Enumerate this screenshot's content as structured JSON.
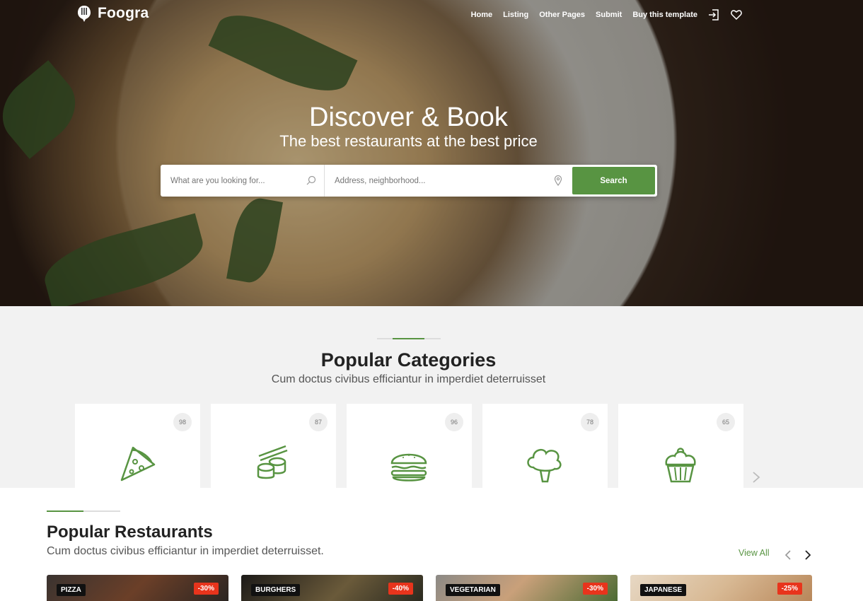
{
  "brand": {
    "name": "Foogra"
  },
  "nav": {
    "items": [
      "Home",
      "Listing",
      "Other Pages",
      "Submit",
      "Buy this template"
    ],
    "icons": [
      "sign-in-icon",
      "heart-icon"
    ]
  },
  "hero": {
    "title": "Discover & Book",
    "subtitle": "The best restaurants at the best price"
  },
  "search": {
    "what_placeholder": "What are you looking for...",
    "where_placeholder": "Address, neighborhood...",
    "button": "Search"
  },
  "categories": {
    "title": "Popular Categories",
    "subtitle": "Cum doctus civibus efficiantur in imperdiet deterruisset",
    "items": [
      {
        "icon": "pizza-icon",
        "count": "98"
      },
      {
        "icon": "sushi-icon",
        "count": "87"
      },
      {
        "icon": "burger-icon",
        "count": "96"
      },
      {
        "icon": "broccoli-icon",
        "count": "78"
      },
      {
        "icon": "cupcake-icon",
        "count": "65"
      }
    ]
  },
  "restaurants": {
    "title": "Popular Restaurants",
    "subtitle": "Cum doctus civibus efficiantur in imperdiet deterruisset.",
    "view_all": "View All",
    "cards": [
      {
        "tag": "PIZZA",
        "discount": "-30%"
      },
      {
        "tag": "BURGHERS",
        "discount": "-40%"
      },
      {
        "tag": "VEGETARIAN",
        "discount": "-30%"
      },
      {
        "tag": "JAPANESE",
        "discount": "-25%"
      }
    ]
  },
  "colors": {
    "accent": "#589442",
    "discount": "#e8341c",
    "tag": "#111111"
  }
}
